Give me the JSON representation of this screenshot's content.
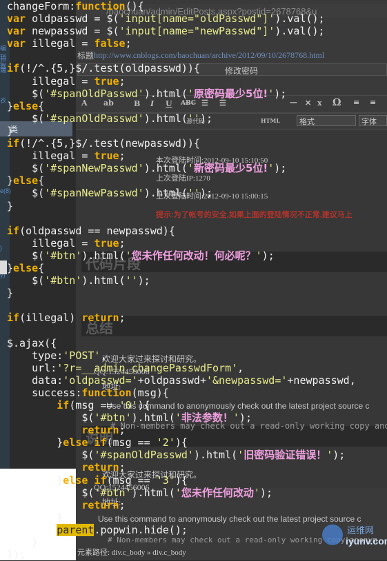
{
  "background": {
    "address_bar_text": "/baochuan/admin/EditPosts.aspx?postid=2678768&u",
    "tab_fragment": "www.cnblogs.com",
    "left_nav_items": [
      "编辑器",
      "户端",
      "",
      "",
      "衣"
    ],
    "sidebar_category": "类",
    "side_counts": [
      "e(8)",
      ")",
      "y)"
    ],
    "title_label": "标题",
    "title_url": "http://www.cnblogs.com/baochuan/archive/2012/09/10/2678768.html",
    "post_title": "修改密码",
    "format_select": "格式",
    "font_select": "字体",
    "source_button": "源代码",
    "html_button": "HTML",
    "login_time": "本次登陆时间:2012-09-10 15:10:50",
    "last_ip": "上次登陆IP:1270",
    "last_time": "上次登陆时间:2012-09-10 15:00:15",
    "tip": "提示:为了帐号的安全,如果上面的登陆情况不正常,建议马上",
    "section_code": "代码片段",
    "section_summary": "总结",
    "section_note": "说明",
    "discussion": "欢迎大家过来探讨和研究。",
    "qq1": "QQ:1524456006",
    "addr1": "地址:",
    "svn_text_1": "Use this command to anonymously check out the latest project source c",
    "svn_text_2": "# Non-members may check out a read-only working copy anony",
    "discussion_2": "欢迎大家过来探讨和研究。",
    "qq2": "QQ:1524456006",
    "addr2": "地址:",
    "svn_text_3": "Use this command to anonymously check out the latest project source c",
    "svn_text_4": "# Non-members may check out a read-only working copy anonym",
    "status_path": "元素路径: div.c_body » div.c_body",
    "watermark_cn": "运维网",
    "watermark_en": "iyunv.com"
  },
  "code_lines": [
    [
      [
        "pl",
        "changeForm:"
      ],
      [
        "kw",
        "function"
      ],
      [
        "pl",
        "(){"
      ]
    ],
    [
      [
        "kw",
        "var "
      ],
      [
        "pl",
        "oldpasswd = $("
      ],
      [
        "str",
        "'input[name=\"oldPasswd\"]'"
      ],
      [
        "pl",
        ").val();"
      ]
    ],
    [
      [
        "kw",
        "var "
      ],
      [
        "pl",
        "newpasswd = $("
      ],
      [
        "str",
        "'input[name=\"newPasswd\"]'"
      ],
      [
        "pl",
        ").val();"
      ]
    ],
    [
      [
        "kw",
        "var "
      ],
      [
        "pl",
        "illegal = "
      ],
      [
        "kw",
        "false"
      ],
      [
        "pl",
        ";"
      ]
    ],
    [
      [
        "pl",
        ""
      ]
    ],
    [
      [
        "kw",
        "if"
      ],
      [
        "pl",
        "(!/^.{5,}$/.test(oldpasswd)){"
      ]
    ],
    [
      [
        "pl",
        "    illegal = "
      ],
      [
        "kw",
        "true"
      ],
      [
        "pl",
        ";"
      ]
    ],
    [
      [
        "pl",
        "    $("
      ],
      [
        "str",
        "'#spanOldPasswd'"
      ],
      [
        "pl",
        ").html("
      ],
      [
        "str",
        "'"
      ],
      [
        "cn",
        "原密码最少5位!"
      ],
      [
        "str",
        "'"
      ],
      [
        "pl",
        ");"
      ]
    ],
    [
      [
        "pl",
        "}"
      ],
      [
        "kw",
        "else"
      ],
      [
        "pl",
        "{"
      ]
    ],
    [
      [
        "pl",
        "    $("
      ],
      [
        "str",
        "'#spanOldPasswd'"
      ],
      [
        "pl",
        ").html("
      ],
      [
        "str",
        "''"
      ],
      [
        "pl",
        ");"
      ]
    ],
    [
      [
        "pl",
        "}"
      ]
    ],
    [
      [
        "kw",
        "if"
      ],
      [
        "pl",
        "(!/^.{5,}$/.test(newpasswd)){"
      ]
    ],
    [
      [
        "pl",
        "    illegal = "
      ],
      [
        "kw",
        "true"
      ],
      [
        "pl",
        ";"
      ]
    ],
    [
      [
        "pl",
        "    $("
      ],
      [
        "str",
        "'#spanNewPasswd'"
      ],
      [
        "pl",
        ").html("
      ],
      [
        "str",
        "'"
      ],
      [
        "cn",
        "新密码最少5位!"
      ],
      [
        "str",
        "'"
      ],
      [
        "pl",
        ");"
      ]
    ],
    [
      [
        "pl",
        "}"
      ],
      [
        "kw",
        "else"
      ],
      [
        "pl",
        "{"
      ]
    ],
    [
      [
        "pl",
        "    $("
      ],
      [
        "str",
        "'#spanNewPasswd'"
      ],
      [
        "pl",
        ").html("
      ],
      [
        "str",
        "''"
      ],
      [
        "pl",
        ");"
      ]
    ],
    [
      [
        "pl",
        "}"
      ]
    ],
    [
      [
        "pl",
        ""
      ]
    ],
    [
      [
        "kw",
        "if"
      ],
      [
        "pl",
        "(oldpasswd == newpasswd){"
      ]
    ],
    [
      [
        "pl",
        "    illegal = "
      ],
      [
        "kw",
        "true"
      ],
      [
        "pl",
        ";"
      ]
    ],
    [
      [
        "pl",
        "    $("
      ],
      [
        "str",
        "'#btn'"
      ],
      [
        "pl",
        ").html("
      ],
      [
        "str",
        "'"
      ],
      [
        "cn",
        "您未作任何改动！何必呢？"
      ],
      [
        "str",
        "'"
      ],
      [
        "pl",
        ");"
      ]
    ],
    [
      [
        "pl",
        "}"
      ],
      [
        "kw",
        "else"
      ],
      [
        "pl",
        "{"
      ]
    ],
    [
      [
        "pl",
        "    $("
      ],
      [
        "str",
        "'#btn'"
      ],
      [
        "pl",
        ").html("
      ],
      [
        "str",
        "''"
      ],
      [
        "pl",
        ");"
      ]
    ],
    [
      [
        "pl",
        "}"
      ]
    ],
    [
      [
        "pl",
        ""
      ]
    ],
    [
      [
        "kw",
        "if"
      ],
      [
        "pl",
        "(illegal) "
      ],
      [
        "kw",
        "return"
      ],
      [
        "pl",
        ";"
      ]
    ],
    [
      [
        "pl",
        ""
      ]
    ],
    [
      [
        "pl",
        "$.ajax({"
      ]
    ],
    [
      [
        "pl",
        "    type:"
      ],
      [
        "str",
        "'POST'"
      ],
      [
        "pl",
        ","
      ]
    ],
    [
      [
        "pl",
        "    url:"
      ],
      [
        "str",
        "'?r=__admin_changePasswdForm'"
      ],
      [
        "pl",
        ","
      ]
    ],
    [
      [
        "pl",
        "    data:"
      ],
      [
        "str",
        "'oldpasswd='"
      ],
      [
        "pl",
        "+oldpasswd+"
      ],
      [
        "str",
        "'&newpasswd='"
      ],
      [
        "pl",
        "+newpasswd,"
      ]
    ],
    [
      [
        "pl",
        "    success:"
      ],
      [
        "kw",
        "function"
      ],
      [
        "pl",
        "(msg){"
      ]
    ],
    [
      [
        "pl",
        "        "
      ],
      [
        "kw",
        "if"
      ],
      [
        "pl",
        "(msg == "
      ],
      [
        "str",
        "'0'"
      ],
      [
        "pl",
        "){"
      ]
    ],
    [
      [
        "pl",
        "            $("
      ],
      [
        "str",
        "'#btn'"
      ],
      [
        "pl",
        ").html("
      ],
      [
        "str",
        "'"
      ],
      [
        "cn",
        "非法参数！"
      ],
      [
        "str",
        "'"
      ],
      [
        "pl",
        ");"
      ]
    ],
    [
      [
        "pl",
        "            "
      ],
      [
        "kw",
        "return"
      ],
      [
        "pl",
        ";"
      ]
    ],
    [
      [
        "pl",
        "        }"
      ],
      [
        "kw",
        "else if"
      ],
      [
        "pl",
        "(msg == "
      ],
      [
        "str",
        "'2'"
      ],
      [
        "pl",
        "){"
      ]
    ],
    [
      [
        "pl",
        "            $("
      ],
      [
        "str",
        "'#spanOldPasswd'"
      ],
      [
        "pl",
        ").html("
      ],
      [
        "str",
        "'"
      ],
      [
        "cn",
        "旧密码验证错误！"
      ],
      [
        "str",
        "'"
      ],
      [
        "pl",
        ");"
      ]
    ],
    [
      [
        "pl",
        "            "
      ],
      [
        "kw",
        "return"
      ],
      [
        "pl",
        ";"
      ]
    ],
    [
      [
        "pl",
        "        }"
      ],
      [
        "kw",
        "else if"
      ],
      [
        "pl",
        "(msg == "
      ],
      [
        "str",
        "'3'"
      ],
      [
        "pl",
        "){"
      ]
    ],
    [
      [
        "pl",
        "            $("
      ],
      [
        "str",
        "'#btn'"
      ],
      [
        "pl",
        ").html("
      ],
      [
        "str",
        "'"
      ],
      [
        "cn",
        "您未作任何改动"
      ],
      [
        "str",
        "'"
      ],
      [
        "pl",
        ");"
      ]
    ],
    [
      [
        "pl",
        "            "
      ],
      [
        "kw",
        "return"
      ],
      [
        "pl",
        ";"
      ]
    ],
    [
      [
        "pl",
        "        }"
      ]
    ],
    [
      [
        "pl",
        "        "
      ],
      [
        "hl",
        "parent"
      ],
      [
        "pl",
        ".popwin.hide();"
      ]
    ],
    [
      [
        "pl",
        "    }"
      ]
    ],
    [
      [
        "pl",
        "});"
      ]
    ]
  ]
}
